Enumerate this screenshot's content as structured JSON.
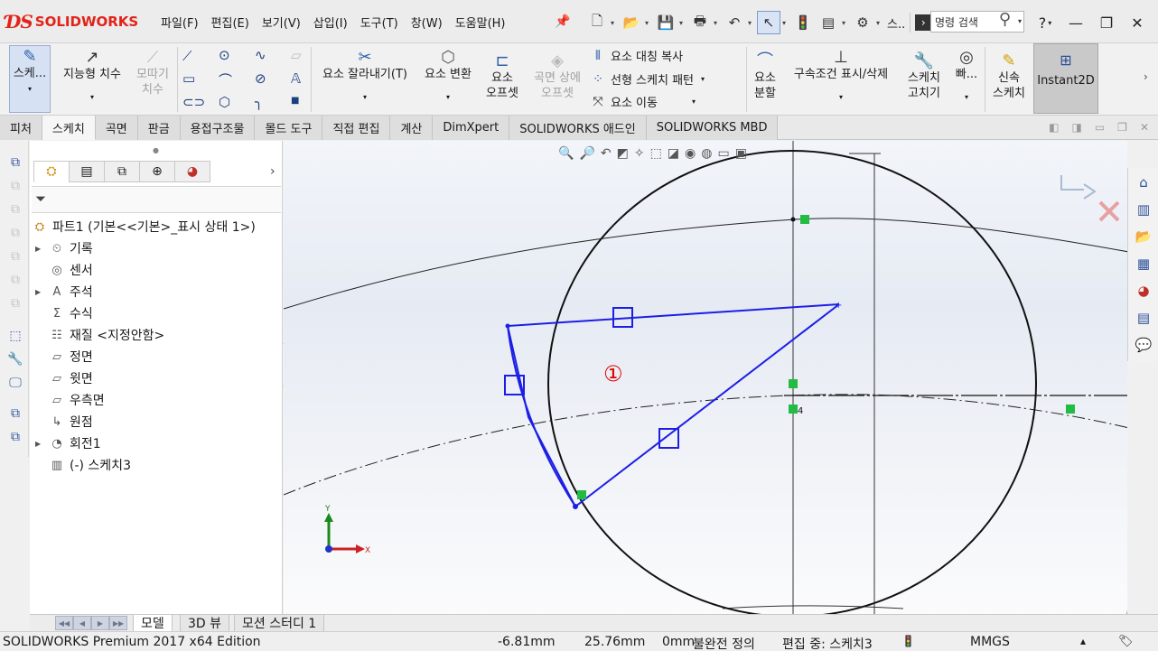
{
  "app": {
    "brand_ds": "3S",
    "brand": "SOLIDWORKS"
  },
  "menu": [
    "파일(F)",
    "편집(E)",
    "보기(V)",
    "삽입(I)",
    "도구(T)",
    "창(W)",
    "도움말(H)"
  ],
  "search": {
    "placeholder": "명령 검색"
  },
  "toolbar": {
    "sketch": "스케...",
    "smart_dimension": "지능형 치수",
    "mirror_disabled_1": "모따기",
    "mirror_disabled_2": "치수",
    "trim": "요소 잘라내기(T)",
    "convert": "요소 변환",
    "offset_1": "요소",
    "offset_2": "오프셋",
    "offset_surface_1": "곡면 상에",
    "offset_surface_2": "오프셋",
    "mirror_entities": "요소 대칭 복사",
    "linear_pattern": "선형 스케치 패턴",
    "move_entities": "요소 이동",
    "split_1": "요소",
    "split_2": "분할",
    "relations": "구속조건 표시/삭제",
    "repair_1": "스케치",
    "repair_2": "고치기",
    "quick": "빠...",
    "rapid_1": "신속",
    "rapid_2": "스케치",
    "instant2d": "Instant2D"
  },
  "tabs": [
    "피처",
    "스케치",
    "곡면",
    "판금",
    "용접구조물",
    "몰드 도구",
    "직접 편집",
    "계산",
    "DimXpert",
    "SOLIDWORKS 애드인",
    "SOLIDWORKS MBD"
  ],
  "active_tab": "스케치",
  "tree": {
    "root": "파트1  (기본<<기본>_표시 상태 1>)",
    "items": [
      {
        "label": "기록",
        "expandable": true,
        "icon": "history-icon"
      },
      {
        "label": "센서",
        "expandable": false,
        "icon": "sensor-icon"
      },
      {
        "label": "주석",
        "expandable": true,
        "icon": "annotation-icon"
      },
      {
        "label": "수식",
        "expandable": false,
        "icon": "equation-icon"
      },
      {
        "label": "재질 <지정안함>",
        "expandable": false,
        "icon": "material-icon"
      },
      {
        "label": "정면",
        "expandable": false,
        "icon": "plane-icon"
      },
      {
        "label": "윗면",
        "expandable": false,
        "icon": "plane-icon"
      },
      {
        "label": "우측면",
        "expandable": false,
        "icon": "plane-icon"
      },
      {
        "label": "원점",
        "expandable": false,
        "icon": "origin-icon"
      },
      {
        "label": "회전1",
        "expandable": true,
        "icon": "revolve-icon"
      },
      {
        "label": "(-) 스케치3",
        "expandable": false,
        "icon": "sketch-icon"
      }
    ]
  },
  "graphics": {
    "annotation": "①",
    "dim_label": "4",
    "triad_x": "X",
    "triad_y": "Y"
  },
  "bottom_tabs": [
    "모델",
    "3D 뷰",
    "모션 스터디 1"
  ],
  "status": {
    "edition": "SOLIDWORKS Premium 2017 x64 Edition",
    "x": "-6.81mm",
    "y": "25.76mm",
    "z": "0mm",
    "state": "불완전 정의",
    "editing": "편집 중: 스케치3",
    "units": "MMGS"
  }
}
